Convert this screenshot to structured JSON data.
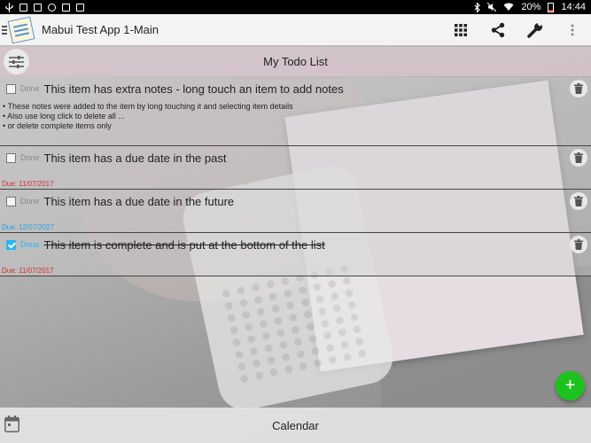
{
  "status_bar": {
    "battery": "20%",
    "time": "14:44"
  },
  "app_bar": {
    "title": "Mabui Test App 1-Main",
    "actions": [
      "apps-grid-icon",
      "share-icon",
      "wrench-icon",
      "overflow-menu-icon"
    ]
  },
  "list": {
    "title": "My Todo List",
    "done_label": "Done",
    "items": [
      {
        "text": "This item has extra notes - long touch an item to add notes",
        "checked": false,
        "notes": [
          "• These notes were added to the item by long touching it and selecting item details",
          "• Also use long click to delete all ...",
          "• or delete complete items only"
        ],
        "due": ""
      },
      {
        "text": "This item has a due date in the past",
        "checked": false,
        "due": "Due: 11/07/2017",
        "due_state": "past"
      },
      {
        "text": "This item has a due date in the future",
        "checked": false,
        "due": "Due: 12/07/2027",
        "due_state": "future"
      },
      {
        "text": "This item is complete and is put at the bottom of the list",
        "checked": true,
        "due": "Due: 11/07/2017",
        "due_state": "past"
      }
    ]
  },
  "fab": {
    "label": "+"
  },
  "bottom_bar": {
    "label": "Calendar"
  },
  "colors": {
    "accent": "#29b6f6",
    "fab": "#1ec21e",
    "due_past": "#d32f2f",
    "due_future": "#29a3e0"
  }
}
